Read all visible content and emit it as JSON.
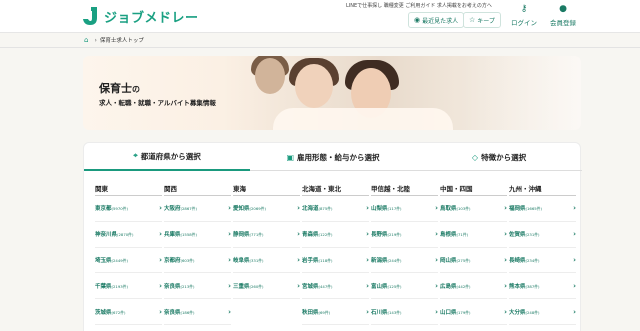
{
  "header": {
    "logo_text": "ジョブメドレー",
    "links": "LINEで仕事探し  職種変更  ご利用ガイド  求人掲載をお考えの方へ",
    "recent_btn": "最近見た求人",
    "keep_btn": "キープ",
    "login_label": "ログイン",
    "register_label": "会員登録"
  },
  "breadcrumb": {
    "current": "保育士求人トップ"
  },
  "hero": {
    "title_main": "保育士",
    "title_no": "の",
    "subtitle": "求人・転職・就職・アルバイト募集情報"
  },
  "tabs": [
    {
      "label": "都道府県から選択",
      "icon": "map-pin-icon"
    },
    {
      "label": "雇用形態・給与から選択",
      "icon": "briefcase-icon"
    },
    {
      "label": "特徴から選択",
      "icon": "tag-icon"
    }
  ],
  "regions": [
    {
      "name": "関東",
      "prefs": [
        {
          "name": "東京都",
          "count": "(5970件)"
        },
        {
          "name": "神奈川県",
          "count": "(2870件)"
        },
        {
          "name": "埼玉県",
          "count": "(2449件)"
        },
        {
          "name": "千葉県",
          "count": "(2193件)"
        },
        {
          "name": "茨城県",
          "count": "(672件)"
        }
      ]
    },
    {
      "name": "関西",
      "prefs": [
        {
          "name": "大阪府",
          "count": "(2867件)"
        },
        {
          "name": "兵庫県",
          "count": "(1558件)"
        },
        {
          "name": "京都府",
          "count": "(603件)"
        },
        {
          "name": "奈良県",
          "count": "(213件)"
        },
        {
          "name": "奈良県",
          "count": "(186件)"
        }
      ]
    },
    {
      "name": "東海",
      "prefs": [
        {
          "name": "愛知県",
          "count": "(2069件)"
        },
        {
          "name": "静岡県",
          "count": "(771件)"
        },
        {
          "name": "岐阜県",
          "count": "(331件)"
        },
        {
          "name": "三重県",
          "count": "(260件)"
        }
      ]
    },
    {
      "name": "北海道・東北",
      "prefs": [
        {
          "name": "北海道",
          "count": "(875件)"
        },
        {
          "name": "青森県",
          "count": "(122件)"
        },
        {
          "name": "岩手県",
          "count": "(118件)"
        },
        {
          "name": "宮城県",
          "count": "(447件)"
        },
        {
          "name": "秋田県",
          "count": "(69件)"
        }
      ]
    },
    {
      "name": "甲信越・北陸",
      "prefs": [
        {
          "name": "山梨県",
          "count": "(117件)"
        },
        {
          "name": "長野県",
          "count": "(219件)"
        },
        {
          "name": "新潟県",
          "count": "(244件)"
        },
        {
          "name": "富山県",
          "count": "(125件)"
        },
        {
          "name": "石川県",
          "count": "(143件)"
        }
      ]
    },
    {
      "name": "中国・四国",
      "prefs": [
        {
          "name": "鳥取県",
          "count": "(103件)"
        },
        {
          "name": "島根県",
          "count": "(71件)"
        },
        {
          "name": "岡山県",
          "count": "(275件)"
        },
        {
          "name": "広島県",
          "count": "(442件)"
        },
        {
          "name": "山口県",
          "count": "(179件)"
        }
      ]
    },
    {
      "name": "九州・沖縄",
      "prefs": [
        {
          "name": "福岡県",
          "count": "(1665件)"
        },
        {
          "name": "佐賀県",
          "count": "(231件)"
        },
        {
          "name": "長崎県",
          "count": "(234件)"
        },
        {
          "name": "熊本県",
          "count": "(387件)"
        },
        {
          "name": "大分県",
          "count": "(248件)"
        }
      ]
    }
  ],
  "colors": {
    "brand": "#1a9a7e",
    "link": "#1a7a64"
  }
}
